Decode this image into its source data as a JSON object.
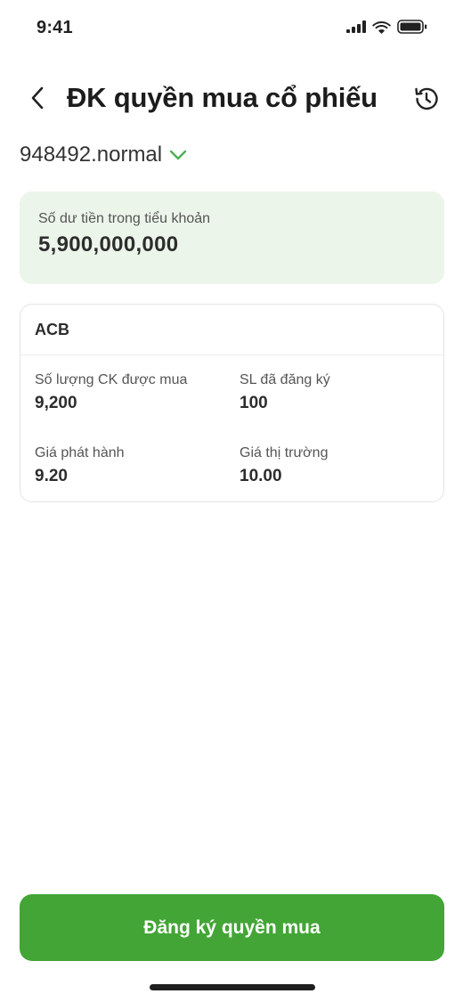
{
  "status_bar": {
    "time": "9:41"
  },
  "header": {
    "title": "ĐK quyền mua cổ phiếu"
  },
  "account": {
    "id": "948492.normal"
  },
  "balance": {
    "label": "Số dư tiền trong tiểu khoản",
    "value": "5,900,000,000"
  },
  "stock": {
    "code": "ACB",
    "fields": [
      {
        "label": "Số lượng CK được mua",
        "value": "9,200"
      },
      {
        "label": "SL đã đăng ký",
        "value": "100"
      },
      {
        "label": "Giá phát hành",
        "value": "9.20"
      },
      {
        "label": "Giá thị trường",
        "value": "10.00"
      }
    ]
  },
  "actions": {
    "submit_label": "Đăng ký quyền mua"
  },
  "colors": {
    "accent": "#43a536",
    "balance_bg": "#ecf5ea",
    "chevron": "#4caf50"
  }
}
